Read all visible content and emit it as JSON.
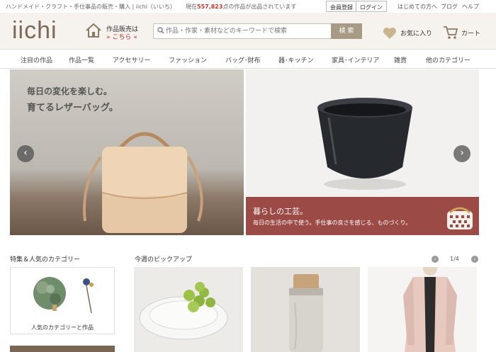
{
  "topbar": {
    "tagline": "ハンドメイド・クラフト・手仕事品の販売・購入 | iichi（いいち）",
    "count_prefix": "現在",
    "count_value": "557,823",
    "count_suffix": "点の作品が出品されています",
    "register": "会員登録",
    "login": "ログイン",
    "beginners": "はじめての方へ",
    "blog": "ブログ",
    "help": "ヘルプ"
  },
  "header": {
    "logo": "iichi",
    "sell_line1": "作品販売は",
    "sell_line2": "» こちら «",
    "search_placeholder": "作品・作家・素材などのキーワードで検索",
    "search_button": "検 索",
    "favorites": "お気に入り",
    "cart": "カート"
  },
  "nav": {
    "items": [
      "注目の作品",
      "作品一覧",
      "アクセサリー",
      "ファッション",
      "バッグ･財布",
      "器･キッチン",
      "家具･インテリア",
      "雑貨",
      "他のカテゴリー"
    ]
  },
  "hero": {
    "left_line1": "毎日の変化を楽しむ。",
    "left_line2": "育てるレザーバッグ。",
    "right_title": "暮らしの工芸。",
    "right_sub": "毎日の生活の中で使う。手仕事の良さを感じる、ものづくり。",
    "prev": "‹",
    "next": "›"
  },
  "featured": {
    "title": "特集＆人気のカテゴリー",
    "card_label": "人気のカテゴリーと作品"
  },
  "pickup": {
    "title": "今週のピックアップ",
    "page": "1/4"
  },
  "colors": {
    "accent": "#c0392b",
    "brand": "#7a6a57",
    "caption_bg": "#9c4a46",
    "header_bg": "#f6f3ee"
  }
}
